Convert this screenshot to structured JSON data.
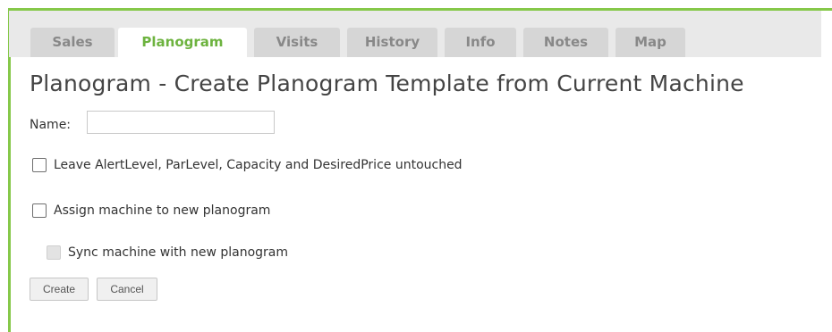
{
  "tabs": [
    {
      "label": "Sales",
      "active": false
    },
    {
      "label": "Planogram",
      "active": true
    },
    {
      "label": "Visits",
      "active": false
    },
    {
      "label": "History",
      "active": false
    },
    {
      "label": "Info",
      "active": false
    },
    {
      "label": "Notes",
      "active": false
    },
    {
      "label": "Map",
      "active": false
    }
  ],
  "page_title": "Planogram - Create Planogram Template from Current Machine",
  "form": {
    "name_label": "Name:",
    "name_value": "",
    "options": [
      {
        "label": "Leave AlertLevel, ParLevel, Capacity and DesiredPrice untouched",
        "checked": false,
        "enabled": true
      },
      {
        "label": "Assign machine to new planogram",
        "checked": false,
        "enabled": true
      },
      {
        "label": "Sync machine with new planogram",
        "checked": false,
        "enabled": false
      }
    ],
    "create_label": "Create",
    "cancel_label": "Cancel"
  },
  "colors": {
    "accent_green": "#6db33f",
    "frame_green": "#86c84a",
    "tab_bg": "#d6d6d6",
    "tab_text": "#888888"
  }
}
